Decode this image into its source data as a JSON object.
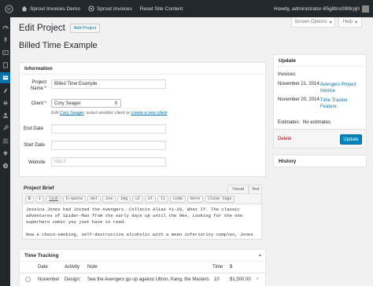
{
  "admin_bar": {
    "site_name": "Sprout Invoices Demo",
    "plugin_name": "Sprout Invoices",
    "reset_label": "Reset Site Content",
    "howdy": "Howdy, administrator-85g8tns09l9rpj0"
  },
  "screen_meta": {
    "screen_options": "Screen Options",
    "help": "Help"
  },
  "page": {
    "title": "Edit Project",
    "add_button": "Add Project"
  },
  "project_title": "Billed Time Example",
  "information": {
    "title": "Information",
    "name_label": "Project Name",
    "name_value": "Billed Time Example",
    "client_label": "Client",
    "client_value": "Cory Seager",
    "client_hint_edit": "Edit",
    "client_hint_link": "Cory Seager",
    "client_hint_mid": ", select another client or",
    "client_hint_create": "create a new client",
    "end_date_label": "End Date",
    "start_date_label": "Start Date",
    "website_label": "Website",
    "website_placeholder": "http://"
  },
  "brief": {
    "title": "Project Brief",
    "tab_visual": "Visual",
    "tab_text": "Text",
    "toolbar": [
      "b",
      "i",
      "link",
      "b-quote",
      "del",
      "ins",
      "img",
      "ul",
      "ol",
      "li",
      "code",
      "more",
      "close tags"
    ],
    "paragraph1": "Jessica Jones had Joined the Avengers. Collects Alias #1-28, What If. The classic adventures of Spider-Man from the early days up until the 90s. Looking for the one superhero comic you just have to read.",
    "paragraph2": "Now a chain-smoking, self-destructive alcoholic with a mean inferiority complex, Jones is"
  },
  "tracking": {
    "title": "Time Tracking",
    "headers": {
      "date": "Date",
      "activity": "Activity",
      "note": "Note",
      "time": "Time",
      "total": "$"
    },
    "row": {
      "date": "November",
      "activity": "Design:",
      "note": "See the Avengers go up against Ultron, Kang, the Masters",
      "time": "10",
      "total": "$1,500.00"
    }
  },
  "update": {
    "title": "Update",
    "invoices_label": "Invoices:",
    "items": [
      {
        "date": "November 21, 2014:",
        "link": "Avengers Project Invoice"
      },
      {
        "date": "November 20, 2014:",
        "link": "Time Tracker Feature"
      }
    ],
    "estimates_label": "Estimates:",
    "estimates_value": "No estimates",
    "delete_label": "Delete",
    "update_label": "Update"
  },
  "history": {
    "title": "History"
  },
  "colors": {
    "admin_bar": "#23282d",
    "accent": "#0073aa",
    "primary_button": "#0085ba",
    "delete": "#aa0000"
  }
}
